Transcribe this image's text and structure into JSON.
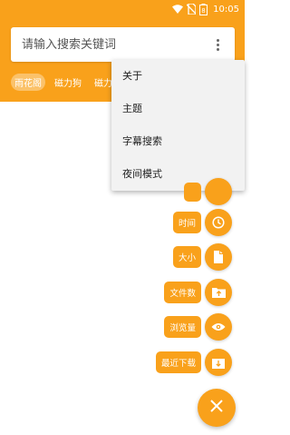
{
  "status_bar": {
    "time": "10:05",
    "battery_level": "8"
  },
  "search": {
    "placeholder": "请输入搜索关键词",
    "value": ""
  },
  "source_tabs": [
    {
      "label": "雨花阁",
      "active": true
    },
    {
      "label": "磁力狗",
      "active": false
    },
    {
      "label": "磁力猫",
      "active": false
    }
  ],
  "menu": {
    "items": [
      {
        "label": "关于"
      },
      {
        "label": "主题"
      },
      {
        "label": "字幕搜索"
      },
      {
        "label": "夜间模式"
      }
    ]
  },
  "sort_options": [
    {
      "label": "时间",
      "icon": "clock-icon"
    },
    {
      "label": "大小",
      "icon": "file-icon"
    },
    {
      "label": "文件数",
      "icon": "folder-upload-icon"
    },
    {
      "label": "浏览量",
      "icon": "eye-icon"
    },
    {
      "label": "最近下载",
      "icon": "download-box-icon"
    }
  ],
  "colors": {
    "accent": "#F9A11B",
    "menu_background": "#F2F2F2"
  },
  "fab": {
    "icon": "close-icon"
  }
}
